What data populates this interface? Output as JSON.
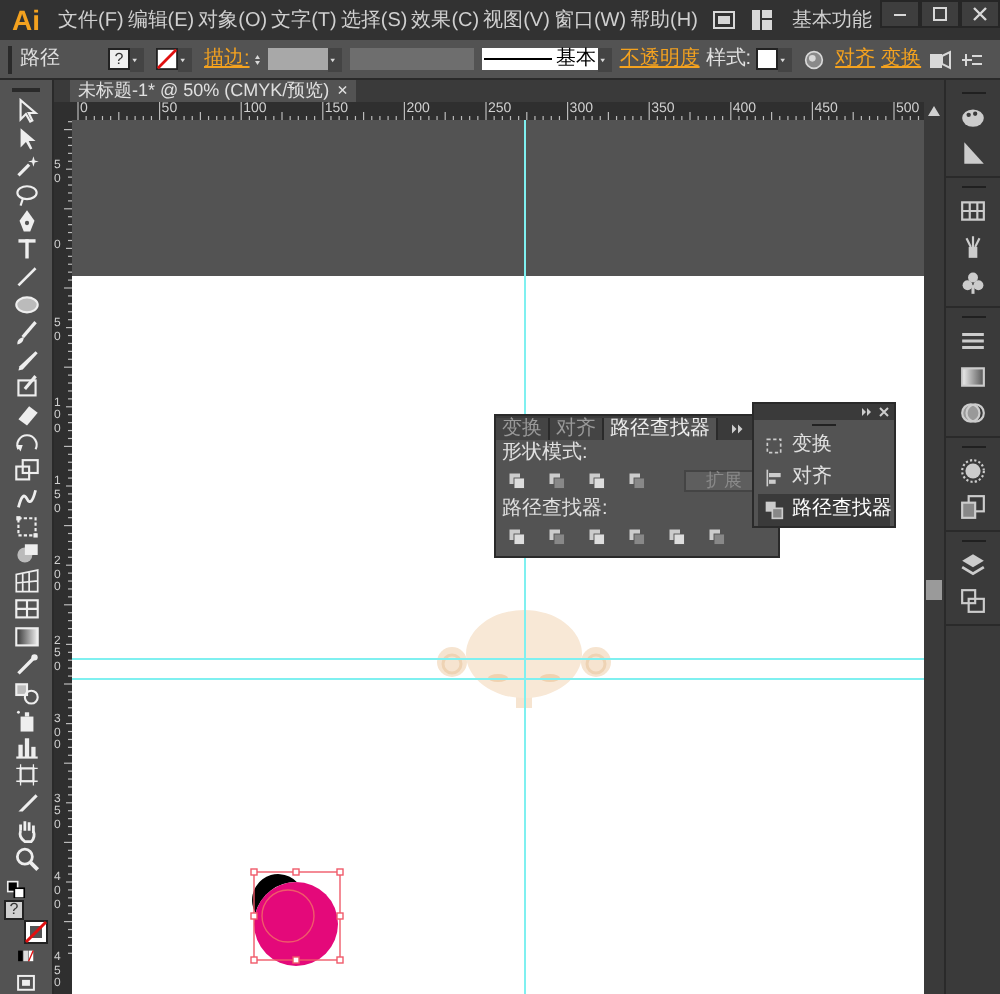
{
  "app_logo": "Ai",
  "menu": [
    "文件(F)",
    "编辑(E)",
    "对象(O)",
    "文字(T)",
    "选择(S)",
    "效果(C)",
    "视图(V)",
    "窗口(W)",
    "帮助(H)"
  ],
  "workspace": "基本功能",
  "control_bar": {
    "selection": "路径",
    "fill_mark": "?",
    "stroke_label": "描边:",
    "stroke_profile": "基本",
    "opacity_label": "不透明度",
    "style_label": "样式:",
    "align_link": "对齐",
    "transform_link": "变换"
  },
  "document_tab": {
    "title": "未标题-1* @ 50% (CMYK/预览)",
    "close": "×"
  },
  "ruler_h": [
    "0",
    "50",
    "100",
    "150",
    "200",
    "250",
    "300",
    "350",
    "400",
    "450",
    "500"
  ],
  "ruler_v": [
    "50",
    "0",
    "50",
    "100",
    "150",
    "200",
    "250",
    "300",
    "350",
    "400",
    "450"
  ],
  "toolbar": {
    "fill_mark": "?"
  },
  "pathfinder_panel": {
    "tabs": [
      {
        "label": "变换",
        "selected": false
      },
      {
        "label": "对齐",
        "selected": false
      },
      {
        "label": "路径查找器",
        "selected": true
      }
    ],
    "shape_modes_label": "形状模式:",
    "expand_button": {
      "label": "扩展",
      "disabled": true
    },
    "pathfinders_label": "路径查找器:"
  },
  "dock_menu": {
    "items": [
      {
        "label": "变换",
        "selected": false
      },
      {
        "label": "对齐",
        "selected": false
      },
      {
        "label": "路径查找器",
        "selected": true
      }
    ]
  }
}
